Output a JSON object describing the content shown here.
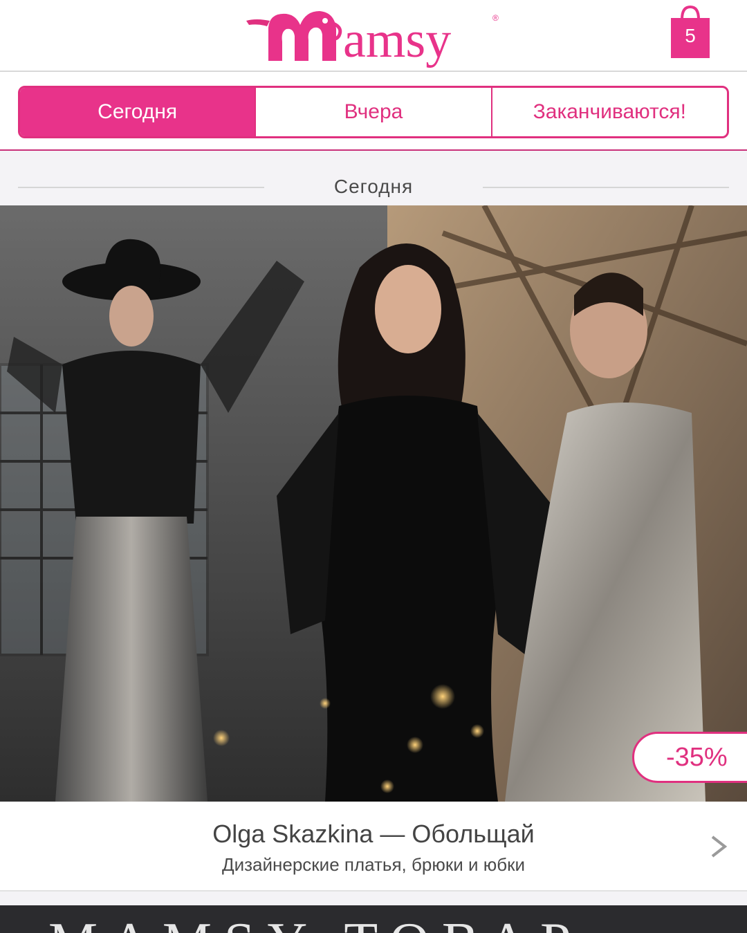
{
  "header": {
    "logo_text": "Mamsy",
    "cart_count": "5",
    "brand_color": "#e8338a"
  },
  "tabs": [
    {
      "label": "Сегодня",
      "active": true
    },
    {
      "label": "Вчера",
      "active": false
    },
    {
      "label": "Заканчиваются!",
      "active": false
    }
  ],
  "section": {
    "title": "Сегодня"
  },
  "promo": {
    "discount": "-35%",
    "brand": "Olga Skazkina — Обольщай",
    "subtitle": "Дизайнерские платья, брюки и юбки"
  },
  "next_promo": {
    "text": "MAMSY ТОВАР"
  },
  "icons": [
    "shopping-bag-icon",
    "chevron-right-icon",
    "mamsy-logo"
  ]
}
